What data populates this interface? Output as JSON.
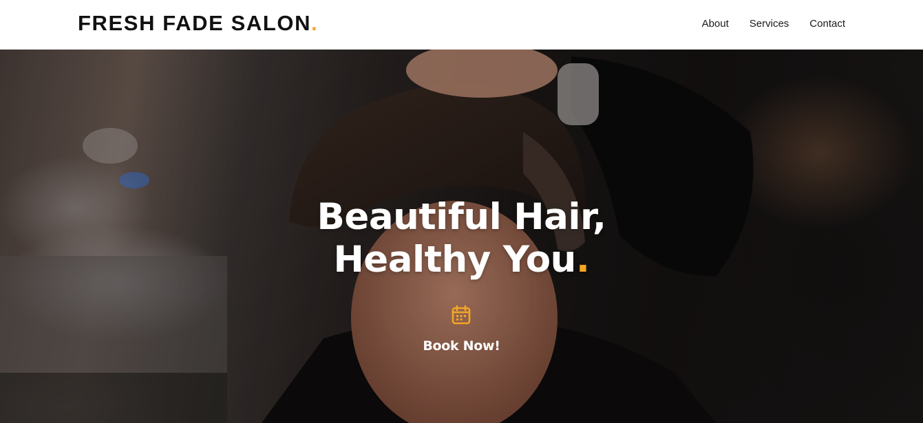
{
  "header": {
    "logo_text": "FRESH FADE SALON",
    "logo_dot": ".",
    "nav": [
      {
        "label": "About"
      },
      {
        "label": "Services"
      },
      {
        "label": "Contact"
      }
    ]
  },
  "hero": {
    "headline_line1": "Beautiful Hair,",
    "headline_line2": "Healthy You",
    "headline_dot": ".",
    "cta_icon": "calendar-icon",
    "cta_label": "Book Now!"
  },
  "colors": {
    "accent": "#f5a623",
    "header_bg": "#ffffff",
    "text_dark": "#111111",
    "text_light": "#ffffff"
  }
}
